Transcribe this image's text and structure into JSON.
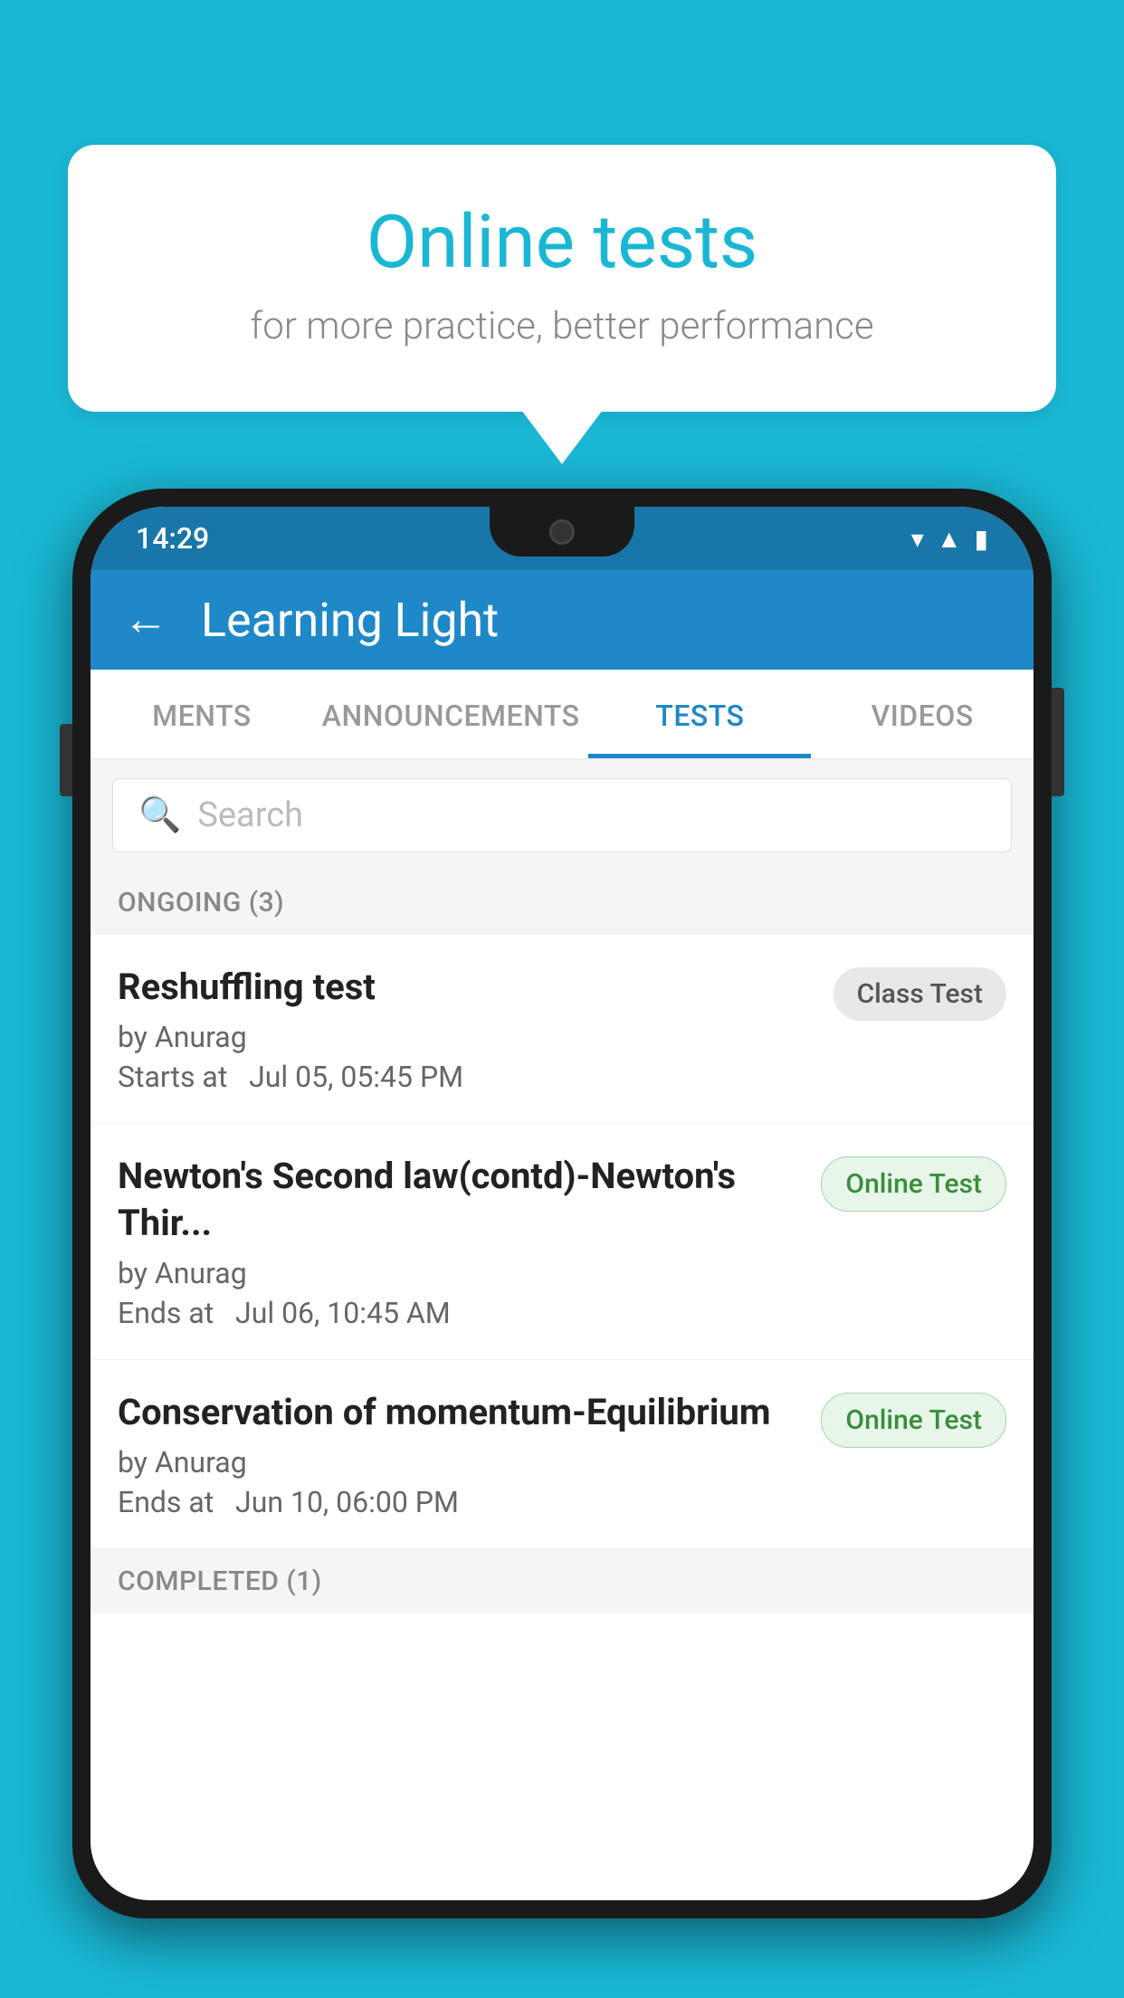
{
  "background": {
    "color": "#1ab7d4"
  },
  "speech_bubble": {
    "title": "Online tests",
    "subtitle": "for more practice, better performance"
  },
  "phone": {
    "status_bar": {
      "time": "14:29",
      "icons": [
        "wifi",
        "signal",
        "battery"
      ]
    },
    "app_bar": {
      "back_label": "←",
      "title": "Learning Light"
    },
    "tabs": [
      {
        "label": "MENTS",
        "active": false
      },
      {
        "label": "ANNOUNCEMENTS",
        "active": false
      },
      {
        "label": "TESTS",
        "active": true
      },
      {
        "label": "VIDEOS",
        "active": false
      }
    ],
    "search": {
      "placeholder": "Search"
    },
    "sections": [
      {
        "title": "ONGOING (3)",
        "tests": [
          {
            "title": "Reshuffling test",
            "author": "by Anurag",
            "time_label": "Starts at",
            "time": "Jul 05, 05:45 PM",
            "badge": "Class Test",
            "badge_type": "class"
          },
          {
            "title": "Newton's Second law(contd)-Newton's Thir...",
            "author": "by Anurag",
            "time_label": "Ends at",
            "time": "Jul 06, 10:45 AM",
            "badge": "Online Test",
            "badge_type": "online"
          },
          {
            "title": "Conservation of momentum-Equilibrium",
            "author": "by Anurag",
            "time_label": "Ends at",
            "time": "Jun 10, 06:00 PM",
            "badge": "Online Test",
            "badge_type": "online"
          }
        ]
      }
    ],
    "completed_section": {
      "title": "COMPLETED (1)"
    }
  }
}
